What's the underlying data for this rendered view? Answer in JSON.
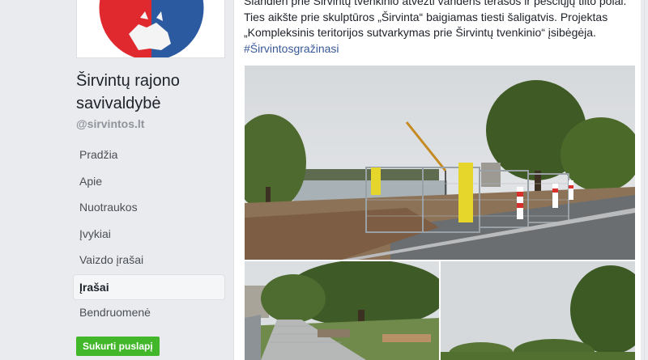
{
  "page": {
    "name": "Širvintų rajono savivaldybė",
    "handle": "@sirvintos.lt"
  },
  "nav": {
    "items": [
      {
        "label": "Pradžia"
      },
      {
        "label": "Apie"
      },
      {
        "label": "Nuotraukos"
      },
      {
        "label": "Įvykiai"
      },
      {
        "label": "Vaizdo įrašai"
      },
      {
        "label": "Įrašai"
      },
      {
        "label": "Bendruomenė"
      }
    ],
    "active": "Įrašai"
  },
  "create_page_button": "Sukurti puslapį",
  "post": {
    "line1": "Šiandien prie Širvintų tvenkinio atvežti vandens terasos ir pėsčiųjų tilto polai.",
    "line2": "Ties aikšte prie skulptūros „Širvinta“ baigiamas tiesti šaligatvis. Projektas",
    "line3": "„Kompleksinis teritorijos sutvarkymas prie Širvintų tvenkinio“ įsibėgėja.",
    "hashtag": "#Širvintosgražinasi"
  },
  "colors": {
    "accent": "#385898",
    "create_button": "#42b72a",
    "logo_red": "#e0292f",
    "logo_blue": "#2c5aa0"
  },
  "icons": {
    "logo": "municipality-coat-of-arms"
  }
}
